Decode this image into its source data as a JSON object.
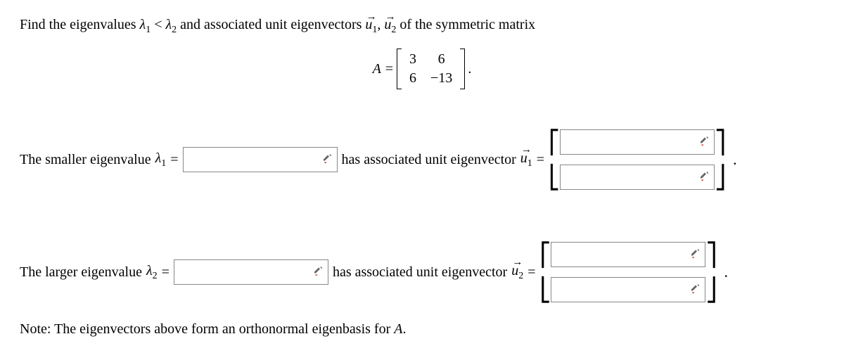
{
  "prompt": {
    "pre": "Find the eigenvalues ",
    "lam1": "λ",
    "sub1": "1",
    "lt": " < ",
    "lam2": "λ",
    "sub2": "2",
    "mid": " and associated unit eigenvectors ",
    "u1": "u",
    "usub1": "1",
    "comma": ", ",
    "u2": "u",
    "usub2": "2",
    "post": " of the symmetric matrix"
  },
  "matrix": {
    "lhs": "A = ",
    "a11": "3",
    "a12": "6",
    "a21": "6",
    "a22": "−13",
    "end": "."
  },
  "row1": {
    "label_pre": "The smaller eigenvalue ",
    "lam": "λ",
    "sub": "1",
    "eq": " = ",
    "mid": " has associated unit eigenvector ",
    "u": "u",
    "usub": "1",
    "eq2": " = "
  },
  "row2": {
    "label_pre": "The larger eigenvalue ",
    "lam": "λ",
    "sub": "2",
    "eq": " = ",
    "mid": " has associated unit eigenvector ",
    "u": "u",
    "usub": "2",
    "eq2": " = "
  },
  "note": {
    "pre": "Note: The eigenvectors above form an orthonormal eigenbasis for ",
    "A": "A",
    "post": "."
  },
  "period": "."
}
